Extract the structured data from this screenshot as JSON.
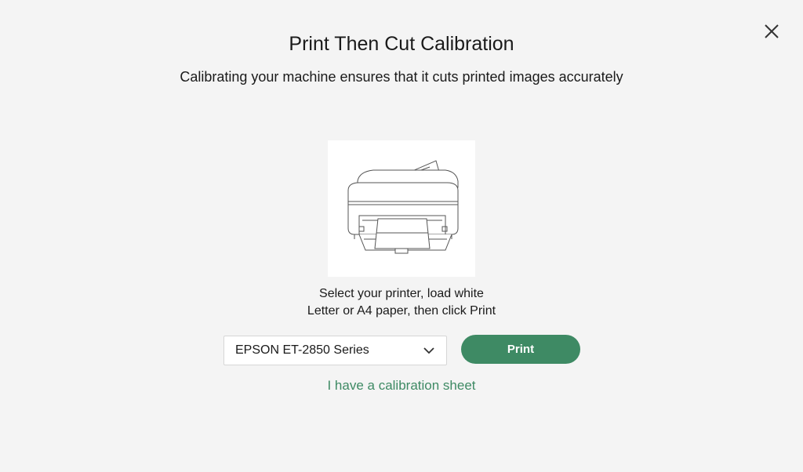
{
  "dialog": {
    "title": "Print Then Cut Calibration",
    "subtitle": "Calibrating your machine ensures that it cuts printed images accurately",
    "close_icon": "close-icon",
    "illustration_icon": "printer-illustration",
    "instructions_line1": "Select your printer, load white",
    "instructions_line2": "Letter or A4 paper, then click Print",
    "printer_select": {
      "value": "EPSON ET-2850 Series",
      "icon": "chevron-down-icon"
    },
    "print_button_label": "Print",
    "calibration_link": "I have a calibration sheet"
  },
  "colors": {
    "background": "#f4f4f4",
    "accent": "#3e8a64",
    "card": "#ffffff"
  }
}
